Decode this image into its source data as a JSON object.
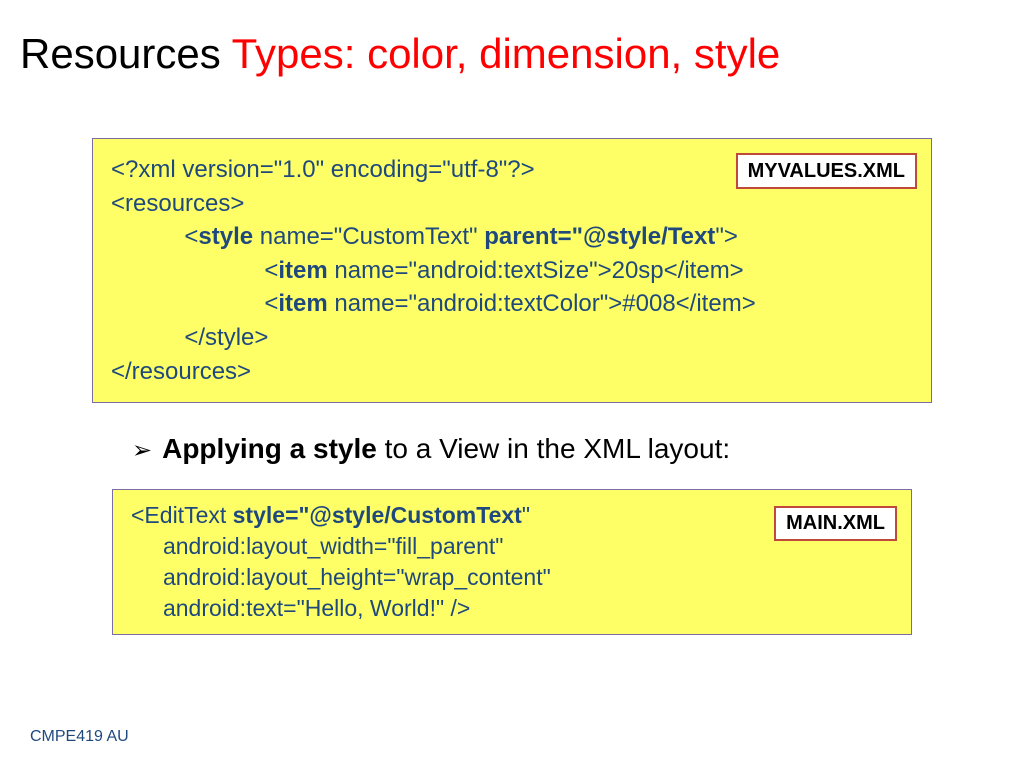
{
  "title": {
    "part1": "Resources ",
    "part2": "Types: color, dimension, style"
  },
  "box1_badge": "MYVALUES.XML",
  "box1": {
    "l1": "<?xml version=\"1.0\" encoding=\"utf-8\"?>",
    "l2": "<resources>",
    "l3a": "<",
    "l3b": "style ",
    "l3c": "name=\"CustomText\" ",
    "l3d": "parent=\"@style/Text",
    "l3e": "\">",
    "l4a": "<",
    "l4b": "item ",
    "l4c": "name=\"android:textSize\">20sp</item>",
    "l5a": "<",
    "l5b": "item ",
    "l5c": "name=\"android:textColor\">#008</item>",
    "l6": "</style>",
    "l7": "</resources>"
  },
  "bullet": {
    "arrow": "➢",
    "bold": "Applying a style",
    "rest": " to a View in the XML layout:"
  },
  "box2_badge": "MAIN.XML",
  "box2": {
    "l1a": "<EditText ",
    "l1b": "style=\"@style/CustomText",
    "l1c": "\"",
    "l2": "android:layout_width=\"fill_parent\"",
    "l3": "android:layout_height=\"wrap_content\"",
    "l4": "android:text=\"Hello, World!\" />"
  },
  "footer": "CMPE419 AU"
}
